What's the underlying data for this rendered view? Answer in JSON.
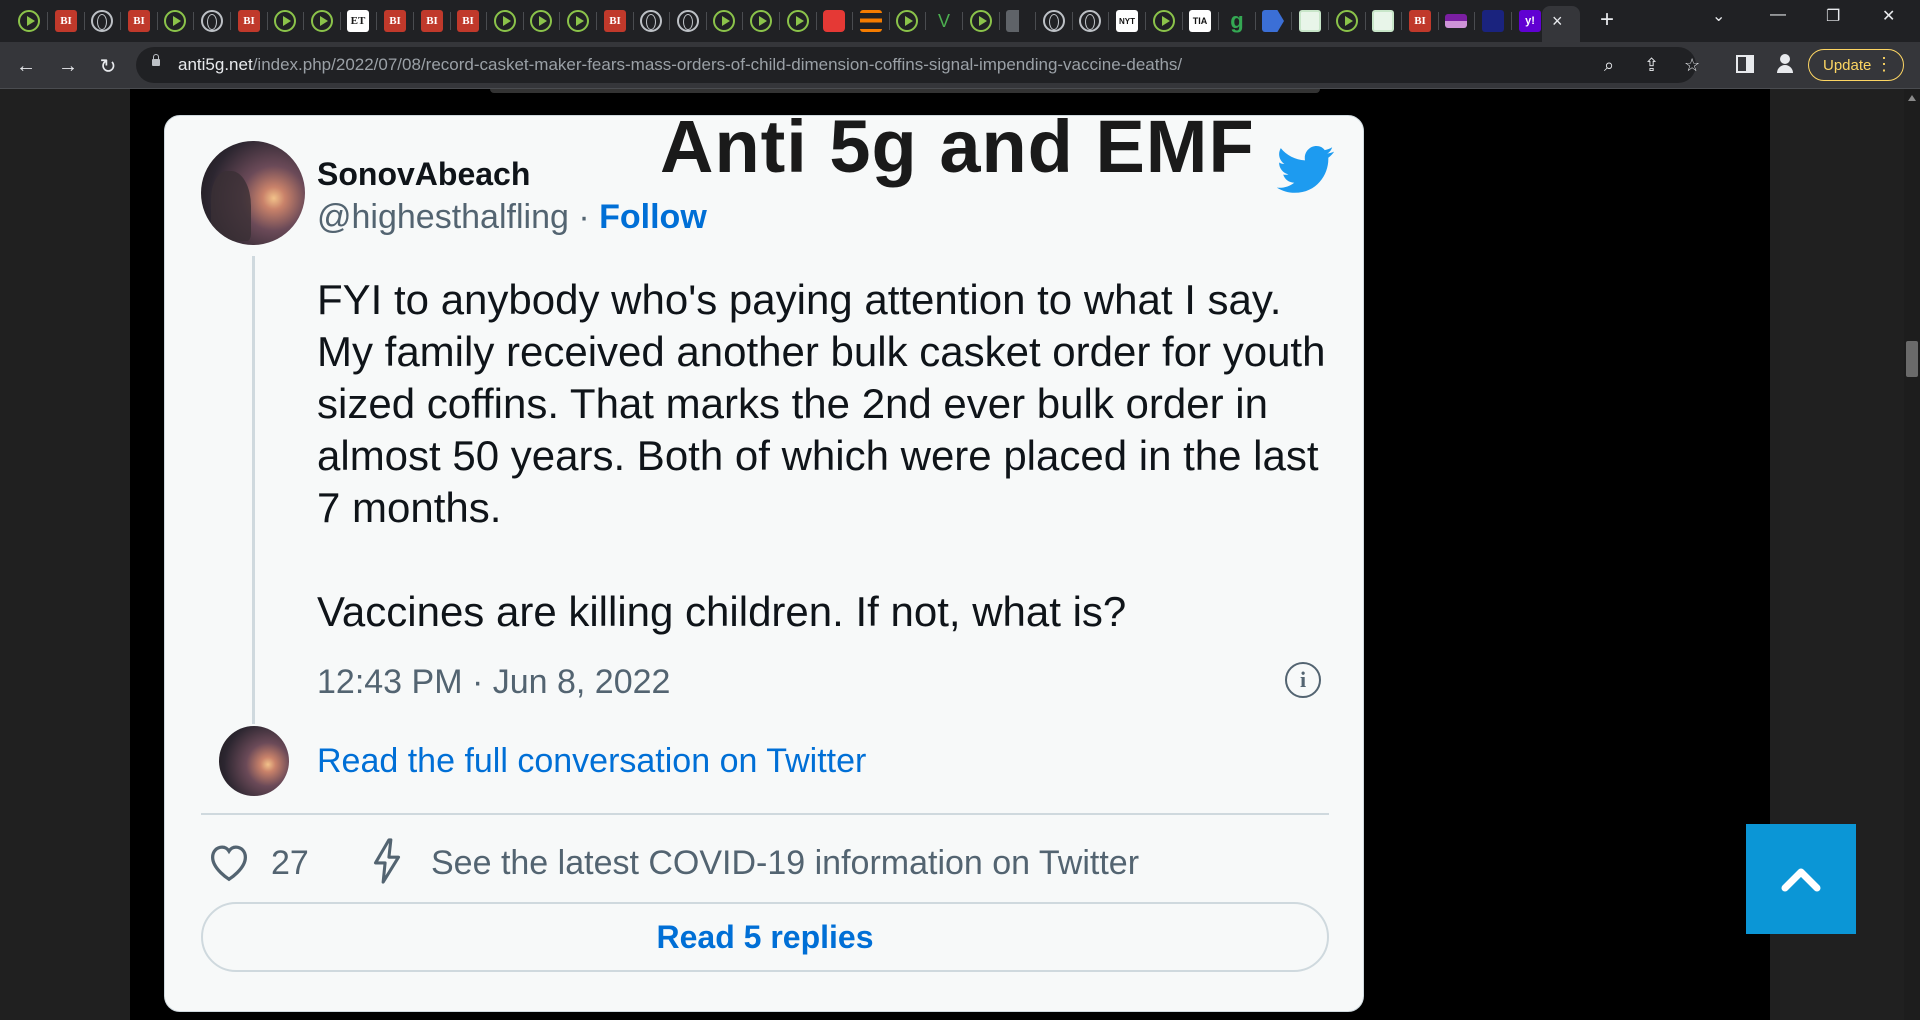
{
  "browser": {
    "tabs": [
      {
        "icon": "play"
      },
      {
        "icon": "bi",
        "label": "BI"
      },
      {
        "icon": "globe"
      },
      {
        "icon": "bi",
        "label": "BI"
      },
      {
        "icon": "play"
      },
      {
        "icon": "globe"
      },
      {
        "icon": "bi",
        "label": "BI"
      },
      {
        "icon": "play"
      },
      {
        "icon": "play"
      },
      {
        "icon": "et",
        "label": "ET"
      },
      {
        "icon": "bi",
        "label": "BI"
      },
      {
        "icon": "bi",
        "label": "BI"
      },
      {
        "icon": "bi",
        "label": "BI"
      },
      {
        "icon": "play"
      },
      {
        "icon": "play"
      },
      {
        "icon": "play"
      },
      {
        "icon": "bi",
        "label": "BI"
      },
      {
        "icon": "globe"
      },
      {
        "icon": "globe"
      },
      {
        "icon": "play"
      },
      {
        "icon": "play"
      },
      {
        "icon": "play"
      },
      {
        "icon": "mic-red"
      },
      {
        "icon": "stack-orange"
      },
      {
        "icon": "play"
      },
      {
        "icon": "v-green",
        "label": "V"
      },
      {
        "icon": "play"
      },
      {
        "icon": "flag-gray"
      },
      {
        "icon": "globe"
      },
      {
        "icon": "globe"
      },
      {
        "icon": "nyt",
        "label": "NYT"
      },
      {
        "icon": "play"
      },
      {
        "icon": "tia",
        "label": "TIA"
      },
      {
        "icon": "g-green",
        "label": "g"
      },
      {
        "icon": "flag-blue"
      },
      {
        "icon": "puzzle"
      },
      {
        "icon": "play"
      },
      {
        "icon": "puzzle"
      },
      {
        "icon": "bi",
        "label": "BI"
      },
      {
        "icon": "mail-purple"
      },
      {
        "icon": "square-navy"
      },
      {
        "icon": "yahoo",
        "label": "y!"
      }
    ],
    "active_tab_close": "×",
    "new_tab": "+",
    "window_controls": {
      "dropdown": "⌄",
      "minimize": "—",
      "restore": "❐",
      "close": "✕"
    },
    "url_host": "anti5g.net",
    "url_path": "/index.php/2022/07/08/record-casket-maker-fears-mass-orders-of-child-dimension-coffins-signal-impending-vaccine-deaths/",
    "update_label": "Update"
  },
  "site": {
    "title": "Anti 5g and EMF"
  },
  "tweet": {
    "author_name": "SonovAbeach",
    "handle": "@highesthalfling",
    "separator": " · ",
    "follow_label": "Follow",
    "paragraph_1": "FYI to anybody who's paying attention to what I say. My family received another bulk casket order for youth sized coffins. That marks the 2nd ever bulk order in almost 50 years. Both of which were placed in the last 7 months.",
    "paragraph_2": "Vaccines are killing children. If not, what is?",
    "timestamp": "12:43 PM · Jun 8, 2022",
    "read_full": "Read the full conversation on Twitter",
    "like_count": "27",
    "covid_info": "See the latest COVID-19 information on Twitter",
    "replies_label": "Read 5 replies",
    "colors": {
      "link": "#006fd6",
      "twitter_blue": "#1d9bf0",
      "text": "#0f1419",
      "muted": "#536471"
    }
  },
  "back_to_top": {
    "icon": "chevron-up-icon",
    "color": "#0b96d6"
  }
}
